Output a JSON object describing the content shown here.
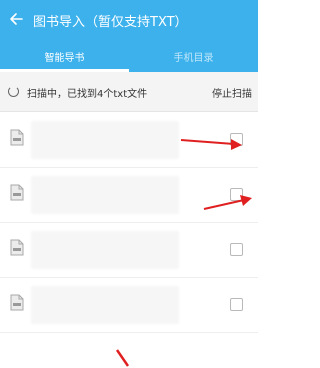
{
  "header": {
    "title": "图书导入（暂仅支持TXT）",
    "back_icon": "back-arrow-icon"
  },
  "tabs": [
    {
      "label": "智能导书",
      "active": true
    },
    {
      "label": "手机目录",
      "active": false
    }
  ],
  "scan": {
    "status": "扫描中，已找到4个txt文件",
    "stop_label": "停止扫描"
  },
  "files": [
    {
      "icon": "txt-file-icon",
      "checked": false
    },
    {
      "icon": "txt-file-icon",
      "checked": false
    },
    {
      "icon": "txt-file-icon",
      "checked": false
    },
    {
      "icon": "txt-file-icon",
      "checked": false
    }
  ],
  "colors": {
    "accent": "#3cb1ec",
    "annotation": "#e02020"
  }
}
